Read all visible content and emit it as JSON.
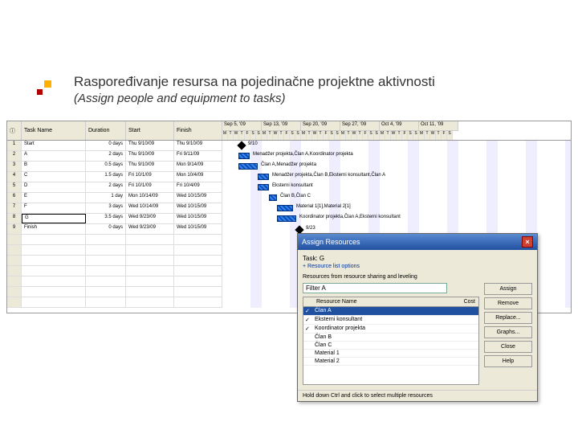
{
  "slide": {
    "title": "Raspoređivanje resursa na pojedinačne projektne aktivnosti",
    "subtitle": "(Assign people and equipment to tasks)"
  },
  "columns": {
    "indicator": "ⓘ",
    "taskname": "Task Name",
    "duration": "Duration",
    "start": "Start",
    "finish": "Finish"
  },
  "timeline_months": [
    "Sep 5, '09",
    "Sep 13, '09",
    "Sep 20, '09",
    "Sep 27, '09",
    "Oct 4, '09",
    "Oct 11, '09"
  ],
  "timeline_days": [
    "M",
    "T",
    "W",
    "T",
    "F",
    "S",
    "S",
    "M",
    "T",
    "W",
    "T",
    "F",
    "S",
    "S",
    "M",
    "T",
    "W",
    "T",
    "F",
    "S",
    "S",
    "M",
    "T",
    "W",
    "T",
    "F",
    "S",
    "S",
    "M",
    "T",
    "W",
    "T",
    "F",
    "S",
    "S",
    "M",
    "T",
    "W",
    "T",
    "F",
    "S"
  ],
  "tasks": [
    {
      "id": "1",
      "name": "Start",
      "duration": "0 days",
      "start": "Thu 9/10/09",
      "finish": "Thu 9/10/09"
    },
    {
      "id": "2",
      "name": "A",
      "duration": "2 days",
      "start": "Thu 9/10/09",
      "finish": "Fri 9/11/09"
    },
    {
      "id": "3",
      "name": "B",
      "duration": "0.5 days",
      "start": "Thu 9/10/09",
      "finish": "Mon 9/14/09"
    },
    {
      "id": "4",
      "name": "C",
      "duration": "1.5 days",
      "start": "Fri 10/1/09",
      "finish": "Mon 10/4/09"
    },
    {
      "id": "5",
      "name": "D",
      "duration": "2 days",
      "start": "Fri 10/1/09",
      "finish": "Fri 10/4/09"
    },
    {
      "id": "6",
      "name": "E",
      "duration": "1 day",
      "start": "Mon 10/14/09",
      "finish": "Wed 10/15/09"
    },
    {
      "id": "7",
      "name": "F",
      "duration": "3 days",
      "start": "Wed 10/14/09",
      "finish": "Wed 10/15/09"
    },
    {
      "id": "8",
      "name": "G",
      "duration": "3.5 days",
      "start": "Wed 9/23/09",
      "finish": "Wed 10/15/09"
    },
    {
      "id": "9",
      "name": "Finish",
      "duration": "0 days",
      "start": "Wed 9/23/09",
      "finish": "Wed 10/15/09"
    }
  ],
  "bar_labels": {
    "start_ms": "9/10",
    "a": "Menadžer projekta,Član A,Koordinator projekta",
    "b": "Član A,Menadžer projekta",
    "c": "Menadžer projekta,Član B,Eksterni konsultant,Član A",
    "d": "Eksterni konsultant",
    "e": "Član B,Član C",
    "f": "Material 1[1],Material 2[1]",
    "g": "Koordinator projekta,Član A,Eksterni konsultant",
    "finish_ms": "9/23"
  },
  "dialog": {
    "title": "Assign Resources",
    "task_label": "Task: G",
    "options": "+ Resource list options",
    "section": "Resources from resource sharing and leveling",
    "filter_label": "Filter A",
    "col_name": "Resource Name",
    "col_cost": "Cost",
    "resources": [
      {
        "checked": true,
        "name": "Član A"
      },
      {
        "checked": true,
        "name": "Eksterni konsultant"
      },
      {
        "checked": true,
        "name": "Koordinator projekta"
      },
      {
        "checked": false,
        "name": "Član B"
      },
      {
        "checked": false,
        "name": "Član C"
      },
      {
        "checked": false,
        "name": "Material 1"
      },
      {
        "checked": false,
        "name": "Material 2"
      }
    ],
    "buttons": {
      "assign": "Assign",
      "remove": "Remove",
      "replace": "Replace...",
      "graphs": "Graphs...",
      "close": "Close",
      "help": "Help"
    },
    "status": "Hold down Ctrl and click to select multiple resources"
  }
}
